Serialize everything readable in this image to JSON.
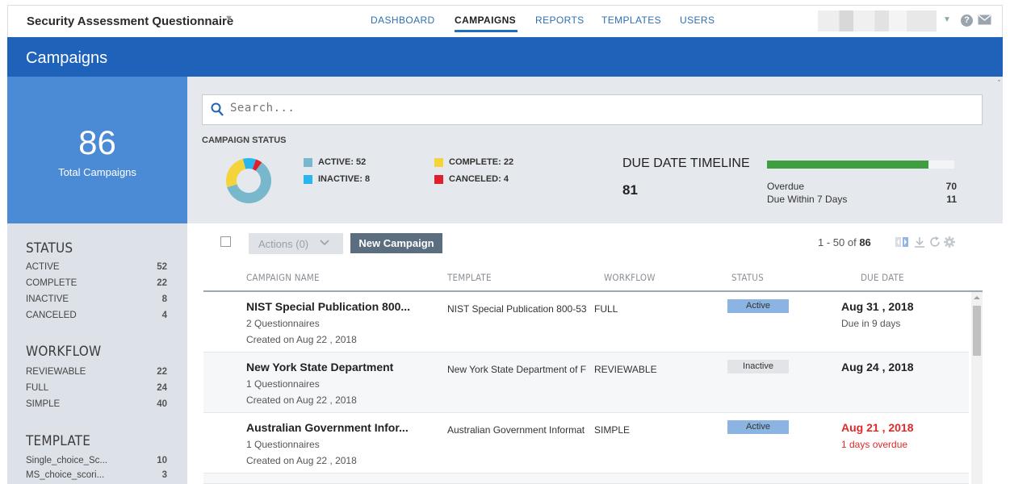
{
  "app": {
    "title": "Security Assessment Questionnaire"
  },
  "nav": {
    "items": [
      "DASHBOARD",
      "CAMPAIGNS",
      "REPORTS",
      "TEMPLATES",
      "USERS"
    ],
    "active": "CAMPAIGNS"
  },
  "header": {
    "title": "Campaigns"
  },
  "summary": {
    "total": "86",
    "total_label": "Total Campaigns"
  },
  "facets": {
    "status": {
      "title": "STATUS",
      "items": [
        {
          "label": "ACTIVE",
          "count": "52"
        },
        {
          "label": "COMPLETE",
          "count": "22"
        },
        {
          "label": "INACTIVE",
          "count": "8"
        },
        {
          "label": "CANCELED",
          "count": "4"
        }
      ]
    },
    "workflow": {
      "title": "WORKFLOW",
      "items": [
        {
          "label": "REVIEWABLE",
          "count": "22"
        },
        {
          "label": "FULL",
          "count": "24"
        },
        {
          "label": "SIMPLE",
          "count": "40"
        }
      ]
    },
    "template": {
      "title": "TEMPLATE",
      "items": [
        {
          "label": "Single_choice_Sc...",
          "count": "10"
        },
        {
          "label": "MS_choice_scori...",
          "count": "3"
        }
      ]
    }
  },
  "search": {
    "placeholder": "Search..."
  },
  "campaign_status": {
    "title": "CAMPAIGN STATUS",
    "legend": [
      {
        "label": "ACTIVE: 52",
        "value": 52,
        "color": "#79b8cc"
      },
      {
        "label": "INACTIVE: 8",
        "value": 8,
        "color": "#29b6ef"
      },
      {
        "label": "COMPLETE: 22",
        "value": 22,
        "color": "#f5d33b"
      },
      {
        "label": "CANCELED: 4",
        "value": 4,
        "color": "#e0202e"
      }
    ]
  },
  "due_timeline": {
    "title": "DUE DATE TIMELINE",
    "total": "81",
    "overdue_label": "Overdue",
    "overdue": "70",
    "due7_label": "Due Within 7 Days",
    "due7": "11",
    "bar_fraction": 0.86,
    "bar_color": "#3f9e3f"
  },
  "toolbar": {
    "actions_label": "Actions (0)",
    "new_label": "New Campaign",
    "range": "1 - 50 of",
    "total": "86"
  },
  "table": {
    "headers": [
      "CAMPAIGN NAME",
      "TEMPLATE",
      "WORKFLOW",
      "STATUS",
      "DUE DATE"
    ],
    "rows": [
      {
        "name": "NIST Special Publication 800...",
        "questionnaires": "2 Questionnaires",
        "created": "Created on Aug 22 , 2018",
        "template": "NIST Special Publication 800-53",
        "workflow": "FULL",
        "status": "Active",
        "due": "Aug 31 , 2018",
        "due_note": "Due in 9 days",
        "overdue": false
      },
      {
        "name": "New York State Department",
        "questionnaires": "1 Questionnaires",
        "created": "Created on Aug 22 , 2018",
        "template": "New York State Department of F",
        "workflow": "REVIEWABLE",
        "status": "Inactive",
        "due": "Aug 24 , 2018",
        "due_note": "",
        "overdue": false
      },
      {
        "name": "Australian Government Infor...",
        "questionnaires": "1 Questionnaires",
        "created": "Created on Aug 22 , 2018",
        "template": "Australian Government Informat",
        "workflow": "SIMPLE",
        "status": "Active",
        "due": "Aug 21 , 2018",
        "due_note": "1 days overdue",
        "overdue": true
      }
    ]
  }
}
